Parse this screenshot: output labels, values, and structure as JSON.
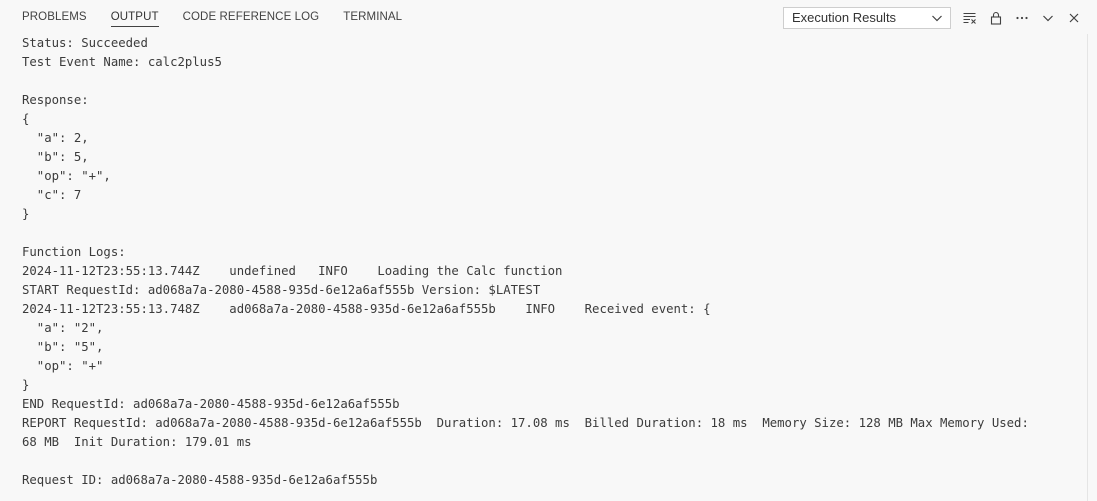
{
  "panel": {
    "tabs": [
      {
        "label": "PROBLEMS"
      },
      {
        "label": "OUTPUT"
      },
      {
        "label": "CODE REFERENCE LOG"
      },
      {
        "label": "TERMINAL"
      }
    ],
    "active_tab": "OUTPUT",
    "channel_select": {
      "value": "Execution Results"
    },
    "toolbar_icons": [
      "clear-output-icon",
      "lock-scroll-icon",
      "more-actions-icon",
      "chevron-down-icon",
      "close-icon"
    ]
  },
  "output": {
    "lines": [
      "Status: Succeeded",
      "Test Event Name: calc2plus5",
      "",
      "Response:",
      "{",
      "  \"a\": 2,",
      "  \"b\": 5,",
      "  \"op\": \"+\",",
      "  \"c\": 7",
      "}",
      "",
      "Function Logs:",
      "2024-11-12T23:55:13.744Z    undefined   INFO    Loading the Calc function",
      "START RequestId: ad068a7a-2080-4588-935d-6e12a6af555b Version: $LATEST",
      "2024-11-12T23:55:13.748Z    ad068a7a-2080-4588-935d-6e12a6af555b    INFO    Received event: {",
      "  \"a\": \"2\",",
      "  \"b\": \"5\",",
      "  \"op\": \"+\"",
      "}",
      "END RequestId: ad068a7a-2080-4588-935d-6e12a6af555b",
      "REPORT RequestId: ad068a7a-2080-4588-935d-6e12a6af555b  Duration: 17.08 ms  Billed Duration: 18 ms  Memory Size: 128 MB Max Memory Used:",
      "68 MB  Init Duration: 179.01 ms",
      "",
      "Request ID: ad068a7a-2080-4588-935d-6e12a6af555b"
    ]
  },
  "colors": {
    "background": "#f8f8f8",
    "text": "#3b3b3b",
    "tab_text": "#424242",
    "active_underline": "#424242"
  }
}
